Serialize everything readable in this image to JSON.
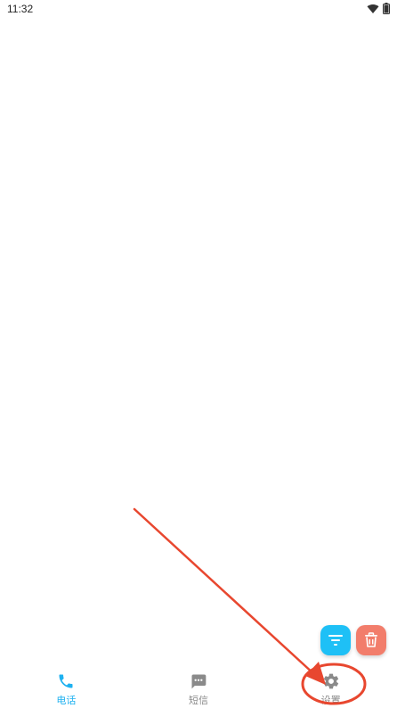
{
  "status_bar": {
    "time": "11:32",
    "icons": [
      "wifi-icon",
      "battery-icon"
    ]
  },
  "fabs": {
    "filter": {
      "icon": "filter-icon",
      "color": "#1EC0F6"
    },
    "delete": {
      "icon": "trash-icon",
      "color": "#F27D6B"
    }
  },
  "bottom_nav": {
    "items": [
      {
        "label": "电话",
        "icon": "phone-icon",
        "active": true
      },
      {
        "label": "短信",
        "icon": "message-icon",
        "active": false
      },
      {
        "label": "设置",
        "icon": "gear-icon",
        "active": false
      }
    ],
    "active_color": "#1EB1F0",
    "inactive_color": "#8A8A8A"
  },
  "annotation": {
    "color": "#E8472F"
  }
}
